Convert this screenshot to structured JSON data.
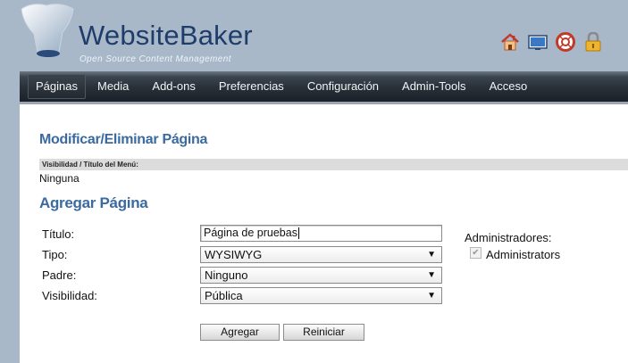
{
  "header": {
    "logo_title": "WebsiteBaker",
    "logo_subtitle": "Open Source Content Management",
    "icons": [
      "home-icon",
      "preview-icon",
      "help-icon",
      "logout-lock-icon"
    ]
  },
  "menu": [
    "Páginas",
    "Media",
    "Add-ons",
    "Preferencias",
    "Configuración",
    "Admin-Tools",
    "Acceso"
  ],
  "modify": {
    "heading": "Modificar/Eliminar Página",
    "table_header": "Visibilidad / Título del Menú:",
    "empty_value": "Ninguna"
  },
  "add": {
    "heading": "Agregar Página",
    "title_label": "Título:",
    "title_value": "Página de pruebas",
    "type_label": "Tipo:",
    "type_value": "WYSIWYG",
    "parent_label": "Padre:",
    "parent_value": "Ninguno",
    "visibility_label": "Visibilidad:",
    "visibility_value": "Pública",
    "admins_label": "Administradores:",
    "admins_value": "Administrators",
    "admins_checked": true,
    "submit_label": "Agregar",
    "reset_label": "Reiniciar"
  },
  "colors": {
    "heading": "#3a6aa0",
    "background": "#a8b8c8",
    "menubar": "#2a323a"
  }
}
